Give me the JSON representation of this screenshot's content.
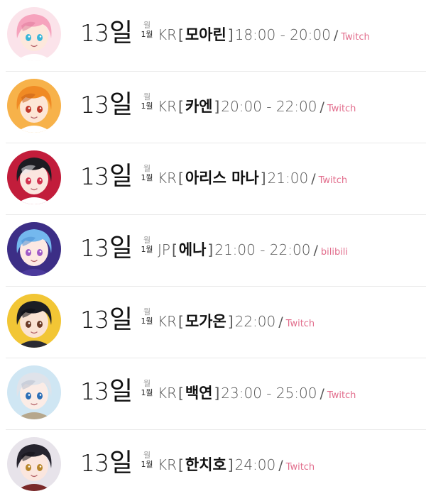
{
  "colors": {
    "platform_link": "#e26d8c",
    "divider": "#e9e9e9",
    "text_dark": "#111111",
    "text_muted": "#555555"
  },
  "schedule": [
    {
      "day_number": "13",
      "day_unit": "일",
      "weekday_top": "월",
      "weekday_bottom": "1월",
      "region": "KR",
      "bracket_open": "[",
      "name": "모아린",
      "bracket_close": "]",
      "time": "18:00 - 20:00",
      "separator": "/",
      "platform": "Twitch",
      "avatar": {
        "hair": "#f6a3bd",
        "hair_dark": "#e07c9c",
        "bg": "#fbe3ea",
        "eye": "#38b6d8",
        "skin": "#fde8dc",
        "accent": "#ffffff"
      }
    },
    {
      "day_number": "13",
      "day_unit": "일",
      "weekday_top": "월",
      "weekday_bottom": "1월",
      "region": "KR",
      "bracket_open": "[",
      "name": "카엔",
      "bracket_close": "]",
      "time": "20:00 - 22:00",
      "separator": "/",
      "platform": "Twitch",
      "avatar": {
        "hair": "#f08a24",
        "hair_dark": "#c9601a",
        "bg": "#f7b24a",
        "eye": "#c0392b",
        "skin": "#fde6d6",
        "accent": "#ffffff"
      }
    },
    {
      "day_number": "13",
      "day_unit": "일",
      "weekday_top": "월",
      "weekday_bottom": "1월",
      "region": "KR",
      "bracket_open": "[",
      "name": "아리스 마나",
      "bracket_close": "]",
      "time": "21:00",
      "separator": "/",
      "platform": "Twitch",
      "avatar": {
        "hair": "#1c1c22",
        "hair_dark": "#e9e9ee",
        "bg": "#c21d3b",
        "eye": "#d2334f",
        "skin": "#fbe6df",
        "accent": "#ffffff"
      }
    },
    {
      "day_number": "13",
      "day_unit": "일",
      "weekday_top": "월",
      "weekday_bottom": "1월",
      "region": "JP",
      "bracket_open": "[",
      "name": "에나",
      "bracket_close": "]",
      "time": "21:00 - 22:00",
      "separator": "/",
      "platform": "bilibili",
      "avatar": {
        "hair": "#74b8ee",
        "hair_dark": "#4c8fd4",
        "bg": "#3c2e86",
        "eye": "#a05ac8",
        "skin": "#fde9e3",
        "accent": "#4b3a9c"
      }
    },
    {
      "day_number": "13",
      "day_unit": "일",
      "weekday_top": "월",
      "weekday_bottom": "1월",
      "region": "KR",
      "bracket_open": "[",
      "name": "모가온",
      "bracket_close": "]",
      "time": "22:00",
      "separator": "/",
      "platform": "Twitch",
      "avatar": {
        "hair": "#1d1d24",
        "hair_dark": "#0c0c12",
        "bg": "#f2c635",
        "eye": "#6b3a26",
        "skin": "#fbe3d3",
        "accent": "#2a2a32"
      }
    },
    {
      "day_number": "13",
      "day_unit": "일",
      "weekday_top": "월",
      "weekday_bottom": "1월",
      "region": "KR",
      "bracket_open": "[",
      "name": "백연",
      "bracket_close": "]",
      "time": "23:00 - 25:00",
      "separator": "/",
      "platform": "Twitch",
      "avatar": {
        "hair": "#dfe3ea",
        "hair_dark": "#b8bfcc",
        "bg": "#cfe6f3",
        "eye": "#2c6fb7",
        "skin": "#fbece6",
        "accent": "#b6a78c"
      }
    },
    {
      "day_number": "13",
      "day_unit": "일",
      "weekday_top": "월",
      "weekday_bottom": "1월",
      "region": "KR",
      "bracket_open": "[",
      "name": "한치호",
      "bracket_close": "]",
      "time": "24:00",
      "separator": "/",
      "platform": "Twitch",
      "avatar": {
        "hair": "#26242e",
        "hair_dark": "#121018",
        "bg": "#e7e3ea",
        "eye": "#b8862a",
        "skin": "#fbe6de",
        "accent": "#7a2a2a"
      }
    }
  ]
}
